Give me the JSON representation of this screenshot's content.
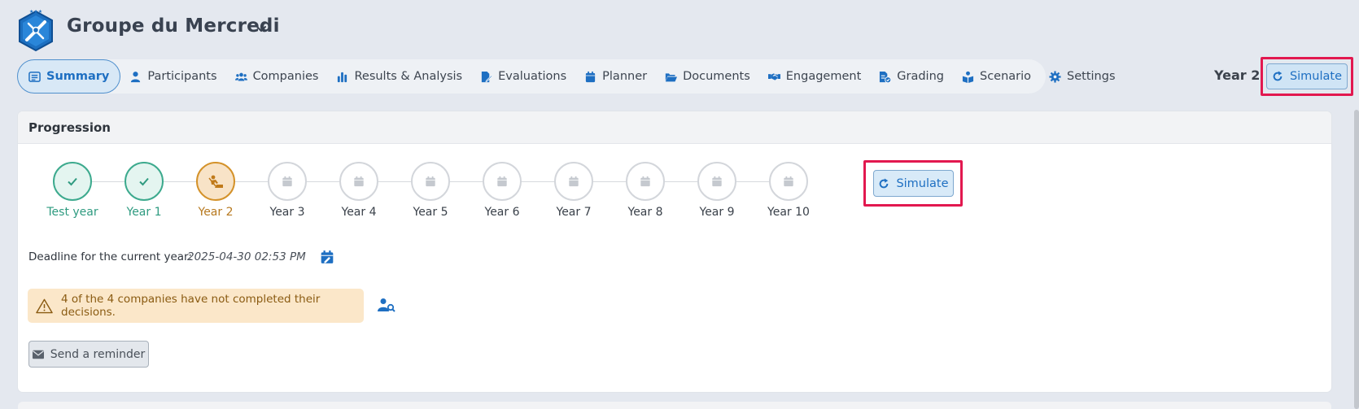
{
  "header": {
    "title": "Groupe du Mercredi",
    "logo_icon": "kayak-badge-icon",
    "dropdown_icon": "chevron-down-icon"
  },
  "nav": {
    "items": [
      {
        "label": "Summary",
        "icon": "list-icon",
        "active": true
      },
      {
        "label": "Participants",
        "icon": "user-icon",
        "active": false
      },
      {
        "label": "Companies",
        "icon": "users-icon",
        "active": false
      },
      {
        "label": "Results & Analysis",
        "icon": "bar-chart-icon",
        "active": false
      },
      {
        "label": "Evaluations",
        "icon": "file-edit-icon",
        "active": false
      },
      {
        "label": "Planner",
        "icon": "calendar-icon",
        "active": false
      },
      {
        "label": "Documents",
        "icon": "folder-open-icon",
        "active": false
      },
      {
        "label": "Engagement",
        "icon": "handshake-icon",
        "active": false
      },
      {
        "label": "Grading",
        "icon": "grade-file-icon",
        "active": false
      },
      {
        "label": "Scenario",
        "icon": "book-reader-icon",
        "active": false
      },
      {
        "label": "Settings",
        "icon": "gear-icon",
        "active": false
      }
    ]
  },
  "toolbar": {
    "current_year": "Year 2",
    "simulate_label": "Simulate"
  },
  "progression": {
    "title": "Progression",
    "steps": [
      {
        "label": "Test year",
        "status": "done"
      },
      {
        "label": "Year 1",
        "status": "done"
      },
      {
        "label": "Year 2",
        "status": "current"
      },
      {
        "label": "Year 3",
        "status": "pending"
      },
      {
        "label": "Year 4",
        "status": "pending"
      },
      {
        "label": "Year 5",
        "status": "pending"
      },
      {
        "label": "Year 6",
        "status": "pending"
      },
      {
        "label": "Year 7",
        "status": "pending"
      },
      {
        "label": "Year 8",
        "status": "pending"
      },
      {
        "label": "Year 9",
        "status": "pending"
      },
      {
        "label": "Year 10",
        "status": "pending"
      }
    ],
    "simulate_label": "Simulate",
    "deadline_label": "Deadline for the current year:",
    "deadline_value": "2025-04-30 02:53 PM",
    "alert_text": "4 of the 4 companies have not completed their decisions.",
    "reminder_label": "Send a reminder"
  },
  "colors": {
    "accent": "#1e6fc2",
    "done": "#3daa8e",
    "current": "#d4922a",
    "highlight": "#e2184f",
    "warning_bg": "#fbe7c9"
  }
}
